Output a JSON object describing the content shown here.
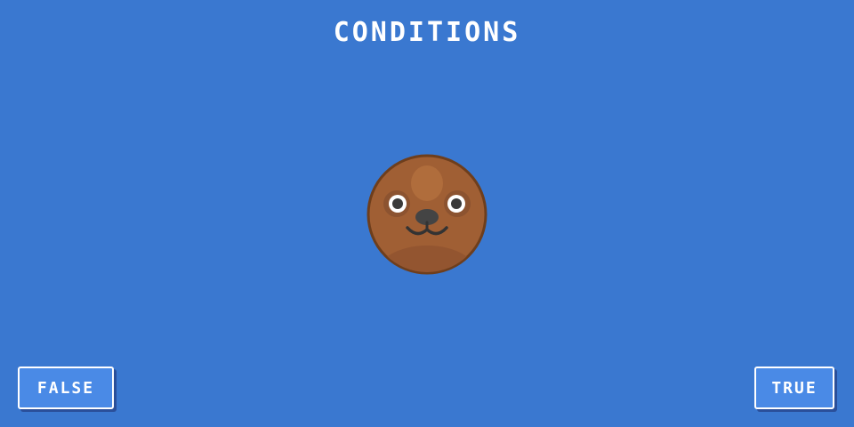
{
  "title": "CONDITIONS",
  "buttons": {
    "false_label": "FALSE",
    "true_label": "TRUE"
  },
  "character": {
    "icon": "seal-face-icon",
    "color": "#a05f34"
  },
  "colors": {
    "background": "#3a78d0",
    "button": "#4a8ae6",
    "button_shadow": "#2a4f9a",
    "text": "#ffffff"
  }
}
